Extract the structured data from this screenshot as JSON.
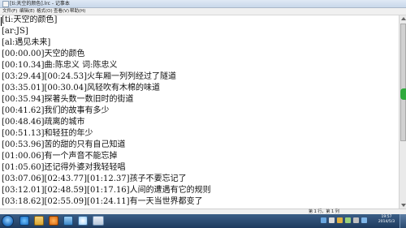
{
  "window": {
    "title": "[ti:天空的颜色].lrc - 记事本"
  },
  "menu": [
    "文件(F)",
    "编辑(E)",
    "格式(O)",
    "查看(V)",
    "帮助(H)"
  ],
  "lines": [
    "[ti:天空的颜色]",
    "[ar:JS]",
    "[al:遇见未来]",
    "[00:00.00]天空的颜色",
    "[00:10.34]曲:陈忠义 词:陈忠义",
    "[03:29.44][00:24.53]火车厢一列列经过了隧道",
    "[03:35.01][00:30.04]风轻吹有木棉的味道",
    "[00:35.94]探著头数一数旧时的街道",
    "[00:41.62]我们的故事有多少",
    "[00:48.46]疏离的城市",
    "[00:51.13]和轻狂的年少",
    "[00:53.96]苦的甜的只有自己知道",
    "[01:00.06]有一个声音不能忘掉",
    "[01:05.60]还记得外婆对我轻轻唱",
    "[03:07.06][02:43.77][01:12.37]孩子不要忘记了",
    "[03:12.01][02:48.59][01:17.16]人间的遭遇有它的规则",
    "[03:18.62][02:55.09][01:24.11]有一天当世界都变了"
  ],
  "statusbar": {
    "position": "第 1 行，第 1 列"
  },
  "taskbar": {
    "clock_time": "19:57",
    "clock_date": "2014/5/3"
  },
  "colors": {
    "accent": "#2faa3d",
    "taskbar": "#1e3a5e"
  },
  "icons": [
    "notepad-icon",
    "start-orb-icon",
    "ie-icon",
    "folder-icon",
    "media-player-icon",
    "app-icon",
    "qq-icon",
    "notepad-task-icon"
  ]
}
